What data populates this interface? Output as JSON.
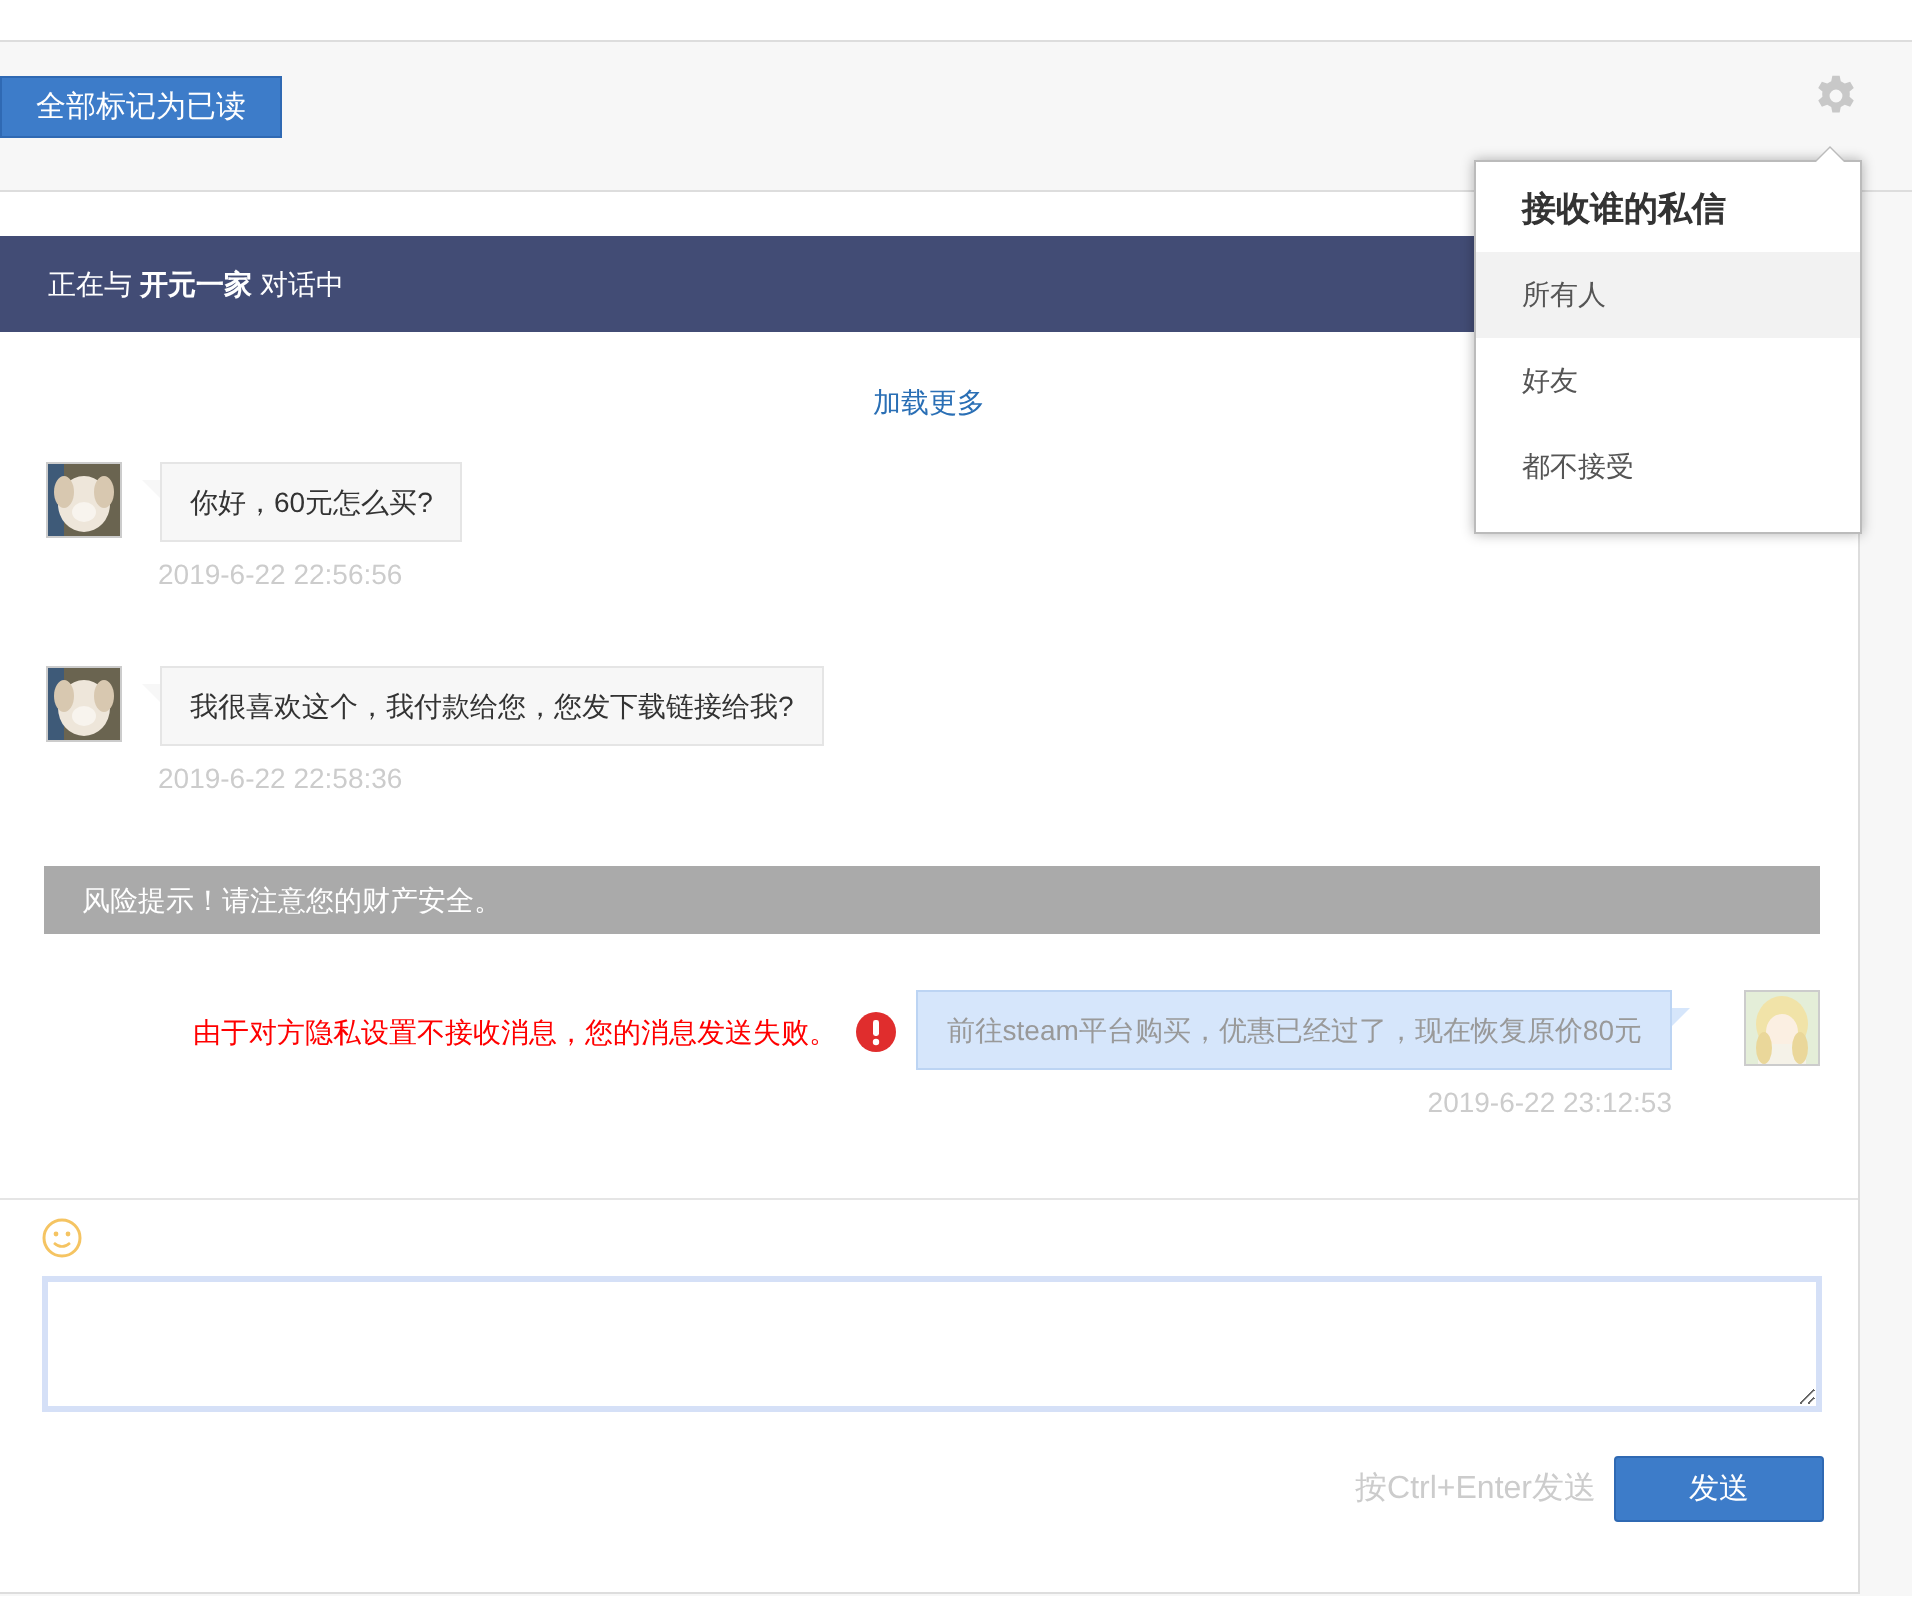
{
  "toolbar": {
    "mark_all_read": "全部标记为已读"
  },
  "privacy_menu": {
    "title": "接收谁的私信",
    "options": [
      {
        "label": "所有人",
        "selected": true
      },
      {
        "label": "好友",
        "selected": false
      },
      {
        "label": "都不接受",
        "selected": false
      }
    ]
  },
  "conversation": {
    "heading": "正在与 **开元一家** 对话中",
    "load_more": "加载更多",
    "messages": [
      {
        "kind": "incoming",
        "text": "你好，60元怎么买?",
        "time": "2019-6-22 22:56:56"
      },
      {
        "kind": "incoming",
        "text": "我很喜欢这个，我付款给您，您发下载链接给我?",
        "time": "2019-6-22 22:58:36"
      },
      {
        "kind": "notice",
        "text": "风险提示！请注意您的财产安全。"
      },
      {
        "kind": "outgoing",
        "text": "前往steam平台购买，优惠已经过了，现在恢复原价80元",
        "time": "2019-6-22 23:12:53",
        "failed": true,
        "error": "由于对方隐私设置不接收消息，您的消息发送失败。"
      }
    ]
  },
  "composer": {
    "hint": "按Ctrl+Enter发送",
    "send": "发送"
  }
}
